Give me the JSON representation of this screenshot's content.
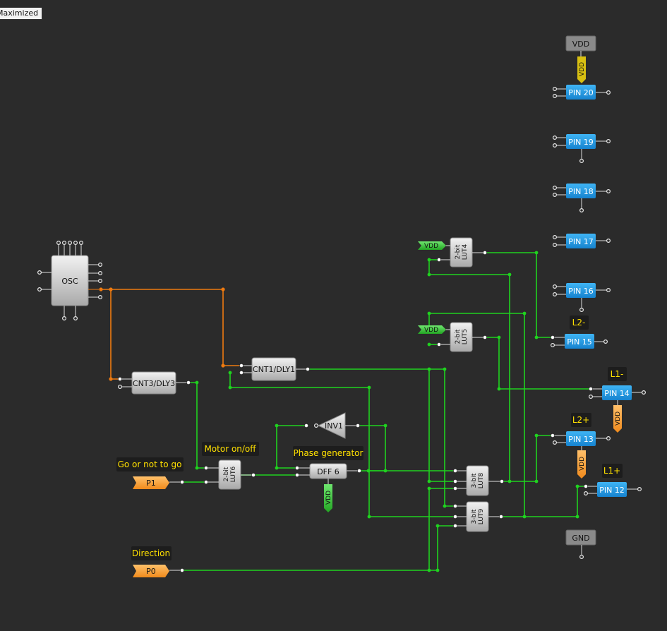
{
  "window": {
    "state_tooltip": "Maximized"
  },
  "blocks": {
    "osc": "OSC",
    "cnt3": "CNT3/DLY3",
    "cnt1": "CNT1/DLY1",
    "inv1": "INV1",
    "dff6": "DFF 6",
    "lut6": "2-bit LUT6",
    "lut4": "2-bit LUT4",
    "lut5": "2-bit LUT5",
    "lut8": "3-bit LUT8",
    "lut9": "3-bit LUT9"
  },
  "pins": {
    "p1": "P1",
    "p0": "P0",
    "pin20": "PIN 20",
    "pin19": "PIN 19",
    "pin18": "PIN 18",
    "pin17": "PIN 17",
    "pin16": "PIN 16",
    "pin15": "PIN 15",
    "pin14": "PIN 14",
    "pin13": "PIN 13",
    "pin12": "PIN 12"
  },
  "supplies": {
    "vdd_top": "VDD",
    "vdd_top_tag": "VDD",
    "vdd_lut4": "VDD",
    "vdd_lut5": "VDD",
    "vdd_dff": "VDD",
    "vdd_pin14": "VDD",
    "vdd_pin13": "VDD",
    "gnd": "GND"
  },
  "notes": {
    "go": "Go or not to go",
    "motor": "Motor on/off",
    "phase": "Phase generator",
    "direction": "Direction",
    "l2minus": "L2-",
    "l1minus": "L1-",
    "l2plus": "L2+",
    "l1plus": "L1+"
  },
  "colors": {
    "background": "#2b2b2b",
    "wire_green": "#1fd21f",
    "wire_orange": "#ee7a10",
    "pin_blue": "#1e9be6",
    "port_orange": "#f7a84a",
    "block_gray": "#cfcfcf",
    "note_yellow": "#ffe000"
  }
}
